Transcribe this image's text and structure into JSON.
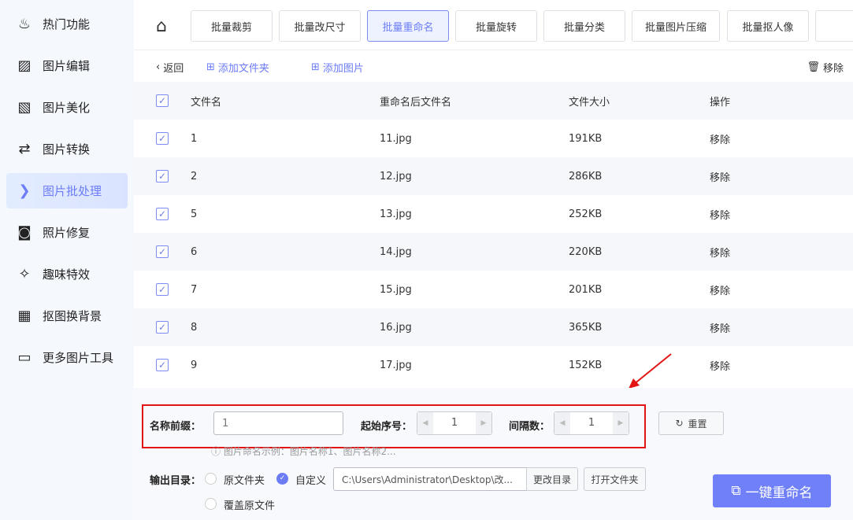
{
  "sidebar": {
    "items": [
      {
        "label": "热门功能",
        "icon": "fire-icon"
      },
      {
        "label": "图片编辑",
        "icon": "image-edit-icon"
      },
      {
        "label": "图片美化",
        "icon": "image-sparkle-icon"
      },
      {
        "label": "图片转换",
        "icon": "convert-icon"
      },
      {
        "label": "图片批处理",
        "icon": "batch-icon"
      },
      {
        "label": "照片修复",
        "icon": "photo-repair-icon"
      },
      {
        "label": "趣味特效",
        "icon": "magic-wand-icon"
      },
      {
        "label": "抠图换背景",
        "icon": "cutout-icon"
      },
      {
        "label": "更多图片工具",
        "icon": "toolbox-icon"
      }
    ],
    "active": "图片批处理"
  },
  "tabs": [
    "批量裁剪",
    "批量改尺寸",
    "批量重命名",
    "批量旋转",
    "批量分类",
    "批量图片压缩",
    "批量抠人像"
  ],
  "toolbar": {
    "back": "返回",
    "add_folder": "添加文件夹",
    "add_image": "添加图片",
    "remove": "移除"
  },
  "table": {
    "headers": [
      "文件名",
      "重命名后文件名",
      "文件大小",
      "操作"
    ],
    "rows": [
      [
        "1",
        "11.jpg",
        "191KB",
        "移除"
      ],
      [
        "2",
        "12.jpg",
        "286KB",
        "移除"
      ],
      [
        "5",
        "13.jpg",
        "252KB",
        "移除"
      ],
      [
        "6",
        "14.jpg",
        "220KB",
        "移除"
      ],
      [
        "7",
        "15.jpg",
        "201KB",
        "移除"
      ],
      [
        "8",
        "16.jpg",
        "365KB",
        "移除"
      ],
      [
        "9",
        "17.jpg",
        "152KB",
        "移除"
      ]
    ]
  },
  "settings": {
    "prefix_label": "名称前缀：",
    "prefix_value": "1",
    "start_label": "起始序号：",
    "start_value": "1",
    "interval_label": "间隔数：",
    "interval_value": "1",
    "reset": "重置",
    "hint": "ⓘ 图片命名示例：图片名称1、图片名称2...",
    "output_label": "输出目录：",
    "opt_original": "原文件夹",
    "opt_custom": "自定义",
    "path": "C:\\Users\\Administrator\\Desktop\\改...",
    "change_dir": "更改目录",
    "open_folder": "打开文件夹",
    "overwrite": "覆盖原文件",
    "go": "一键重命名"
  }
}
